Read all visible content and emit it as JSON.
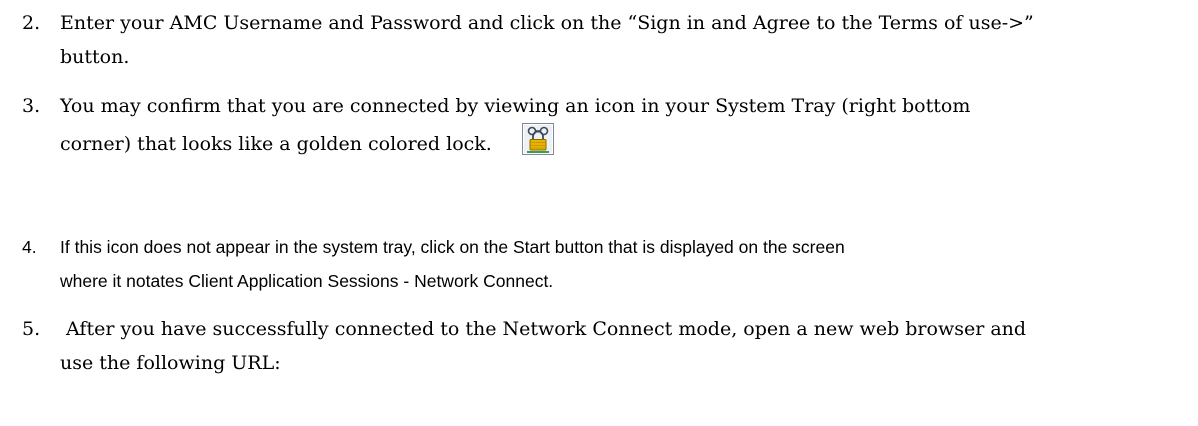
{
  "steps": [
    {
      "number": "2.",
      "lines": [
        "Enter your AMC Username and Password and click on the “Sign in and Agree to the Terms of use->”",
        "button."
      ]
    },
    {
      "number": "3.",
      "lines": [
        "You may confirm that you are connected by viewing an icon in your System Tray (right bottom",
        "corner) that looks like a golden colored lock."
      ],
      "icon": "golden-lock-icon"
    },
    {
      "number": "4.",
      "lines": [
        "If this icon does not appear in the system tray, click on the Start button that is displayed on the screen",
        "where it notates Client Application Sessions - Network Connect."
      ]
    },
    {
      "number": "5.",
      "lines": [
        " After you have successfully connected to the Network Connect mode, open a new web browser and",
        "use the following URL:"
      ]
    }
  ],
  "icon_colors": {
    "lock_body": "#e8b400",
    "lock_shackle": "#3a4a60",
    "icon_frame": "#7d8a99"
  }
}
